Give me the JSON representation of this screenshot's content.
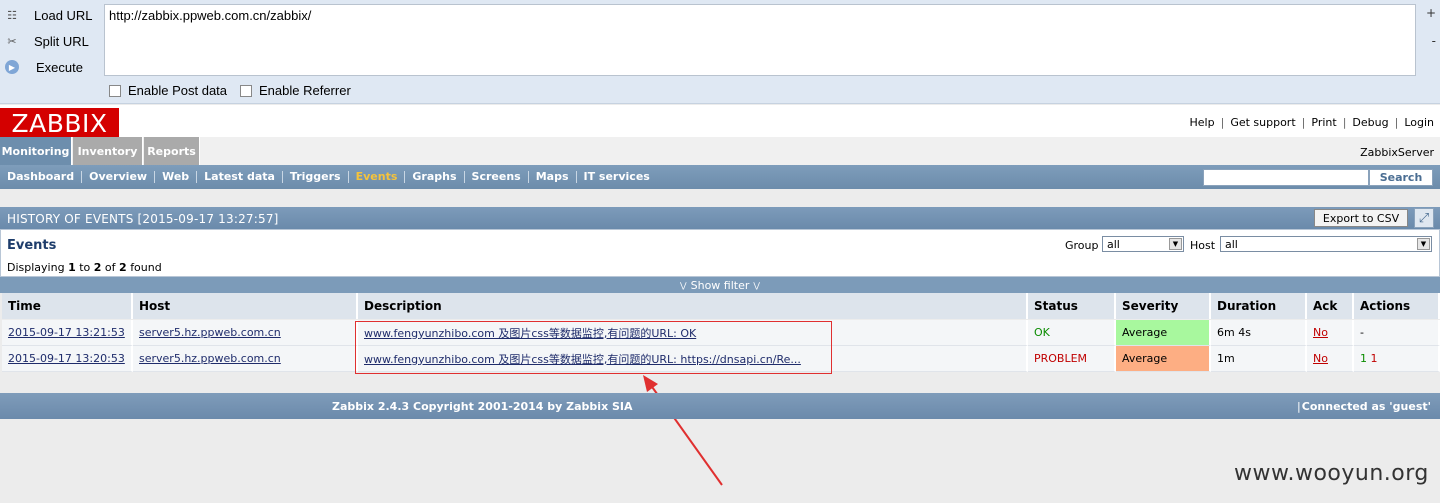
{
  "hackbar": {
    "load_url": "Load URL",
    "split_url": "Split URL",
    "execute": "Execute",
    "url_value": "http://zabbix.ppweb.com.cn/zabbix/",
    "enable_post": "Enable Post data",
    "enable_referrer": "Enable Referrer",
    "plus": "+",
    "minus": "-"
  },
  "header": {
    "logo": "ZABBIX",
    "links": [
      "Help",
      "Get support",
      "Print",
      "Debug",
      "Login"
    ],
    "menu_tabs": [
      "Monitoring",
      "Inventory",
      "Reports"
    ],
    "active_tab": "Monitoring",
    "server_name": "ZabbixServer",
    "submenu": [
      "Dashboard",
      "Overview",
      "Web",
      "Latest data",
      "Triggers",
      "Events",
      "Graphs",
      "Screens",
      "Maps",
      "IT services"
    ],
    "active_submenu": "Events",
    "search_button": "Search"
  },
  "history": {
    "title": "HISTORY OF EVENTS [2015-09-17 13:27:57]",
    "export_button": "Export to CSV"
  },
  "events": {
    "title": "Events",
    "displaying_prefix": "Displaying",
    "from": "1",
    "to_word": "to",
    "to": "2",
    "of_word": "of",
    "total": "2",
    "found_word": "found",
    "group_label": "Group",
    "group_value": "all",
    "host_label": "Host",
    "host_value": "all",
    "show_filter": "Show filter"
  },
  "table": {
    "headers": [
      "Time",
      "Host",
      "Description",
      "Status",
      "Severity",
      "Duration",
      "Ack",
      "Actions"
    ],
    "rows": [
      {
        "time": "2015-09-17 13:21:53",
        "host": "server5.hz.ppweb.com.cn",
        "description": "www.fengyunzhibo.com 及图片css等数据监控,有问题的URL: OK",
        "status": "OK",
        "severity": "Average",
        "duration": "6m 4s",
        "ack": "No",
        "actions": "-"
      },
      {
        "time": "2015-09-17 13:20:53",
        "host": "server5.hz.ppweb.com.cn",
        "description": "www.fengyunzhibo.com 及图片css等数据监控,有问题的URL: https://dnsapi.cn/Re...",
        "status": "PROBLEM",
        "severity": "Average",
        "duration": "1m",
        "ack": "No",
        "actions_green": "1",
        "actions_red": "1"
      }
    ]
  },
  "footer": {
    "copyright": "Zabbix 2.4.3 Copyright 2001-2014 by Zabbix SIA",
    "connected": "Connected as 'guest'"
  },
  "watermark": "www.wooyun.org",
  "colors": {
    "logo_red": "#d40000",
    "nav_blue": "#6d8ead",
    "active_submenu": "#f5c33b",
    "ok_green": "#0a8c00",
    "problem_red": "#c00000",
    "severity_average_ok": "#a8f89e",
    "severity_average_problem": "#fdae83",
    "annotation_red": "#e03030"
  }
}
